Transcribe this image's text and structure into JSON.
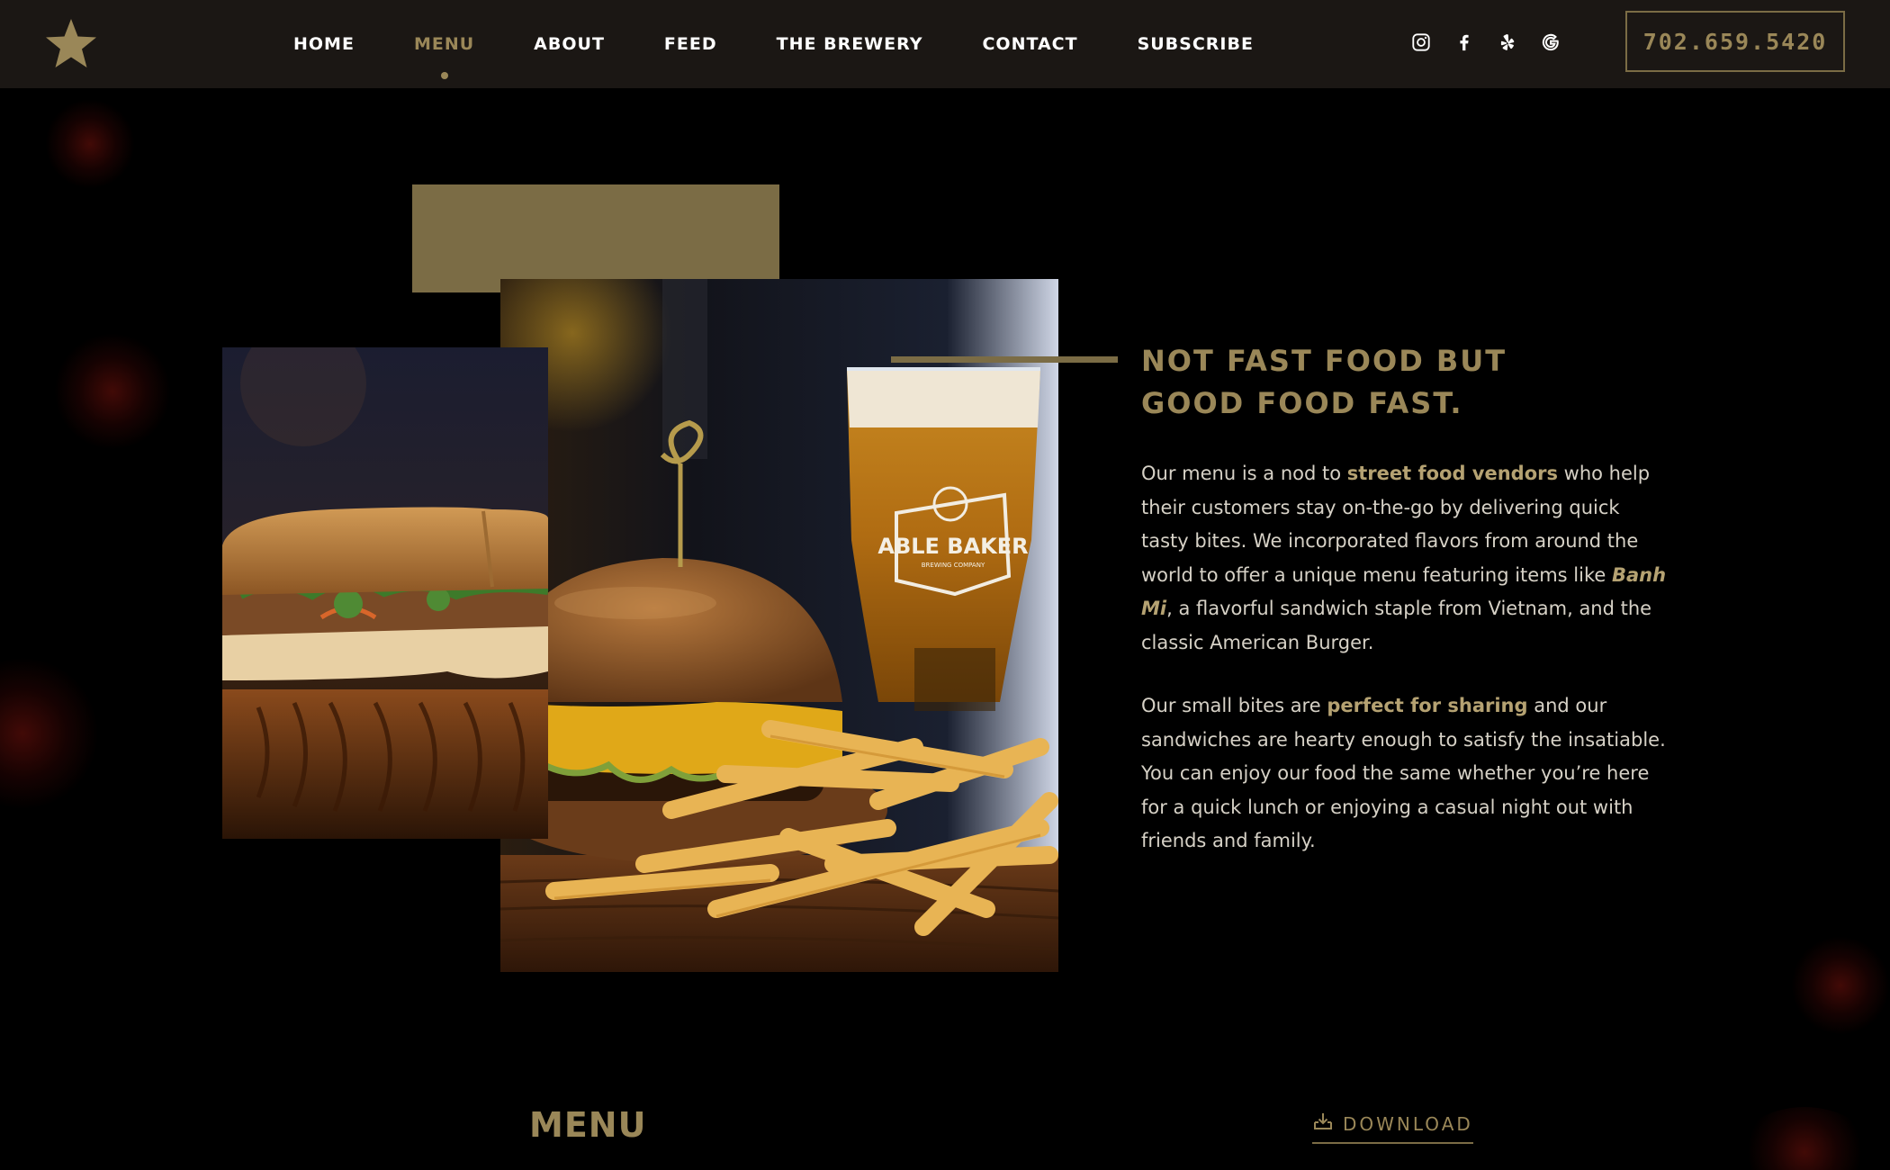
{
  "header": {
    "logo_icon": "star-icon",
    "nav": [
      {
        "label": "HOME"
      },
      {
        "label": "MENU",
        "active": true
      },
      {
        "label": "ABOUT"
      },
      {
        "label": "FEED"
      },
      {
        "label": "THE BREWERY"
      },
      {
        "label": "CONTACT"
      },
      {
        "label": "SUBSCRIBE"
      }
    ],
    "socials": [
      "instagram-icon",
      "facebook-icon",
      "yelp-icon",
      "google-icon"
    ],
    "phone": "702.659.5420"
  },
  "hero": {
    "images": [
      {
        "name": "burger-fries-beer-photo",
        "caption_on_glass": "ABLE BAKER",
        "caption_small": "BREWING COMPANY"
      },
      {
        "name": "banh-mi-photo"
      }
    ],
    "headline_line1": "NOT FAST FOOD BUT",
    "headline_line2": "GOOD FOOD FAST.",
    "paragraph1": {
      "t1": "Our menu is a nod to ",
      "b1": "street food vendors",
      "t2": " who help their customers stay on-the-go by delivering quick tasty bites. We incorporated flavors from around the world to offer a unique menu featuring items like ",
      "b2": "Banh Mi",
      "t3": ", a flavorful sandwich staple from Vietnam, and the classic American Burger."
    },
    "paragraph2": {
      "t1": "Our small bites are ",
      "b1": "perfect for sharing",
      "t2": " and our sandwiches are hearty enough to satisfy the insatiable. You can enjoy our food the same whether you’re here for a quick lunch or enjoying a casual night out with friends and family."
    }
  },
  "menu_section": {
    "heading": "MENU",
    "download_label": "DOWNLOAD",
    "download_icon": "download-icon"
  },
  "colors": {
    "gold": "#9a8758",
    "gold_dark": "#7b6c45",
    "header_bg": "#1b1714",
    "page_bg": "#000000"
  }
}
